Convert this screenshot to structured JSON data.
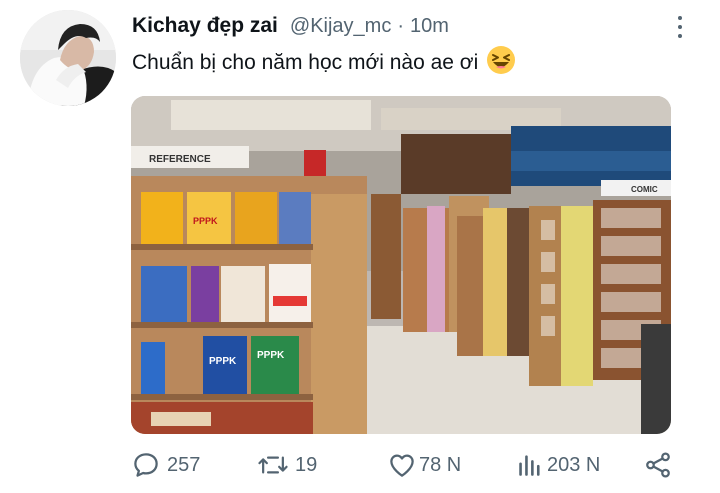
{
  "tweet": {
    "author": {
      "display_name": "Kichay đẹp zai",
      "handle": "@Kijay_mc",
      "separator": "·",
      "time": "10m"
    },
    "text": "Chuẩn bị cho năm học mới nào ae ơi",
    "emoji": "😆",
    "image_signs": {
      "reference": "REFERENCE",
      "comic": "COMIC",
      "book_1": "PPPK",
      "book_2": "PPPK",
      "book_3": "PPPK"
    },
    "actions": {
      "replies": "257",
      "retweets": "19",
      "likes": "78 N",
      "views": "203 N"
    }
  },
  "colors": {
    "text_primary": "#0f1419",
    "text_secondary": "#536471"
  },
  "icons": {
    "reply": "reply-icon",
    "retweet": "retweet-icon",
    "like": "heart-icon",
    "views": "views-icon",
    "share": "share-icon",
    "more": "more-icon"
  }
}
